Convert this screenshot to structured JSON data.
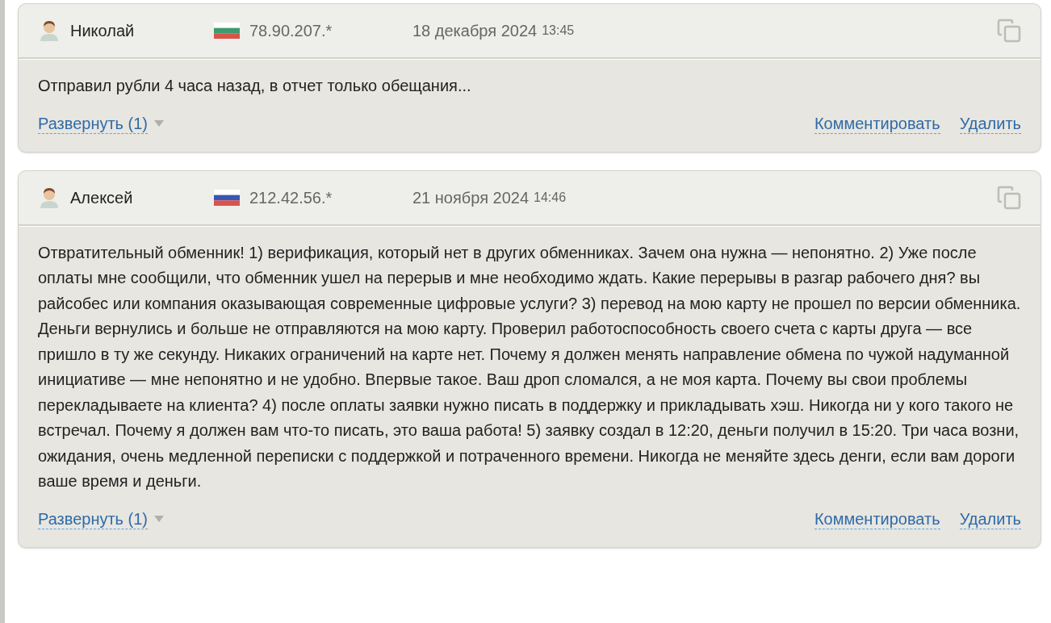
{
  "comments": [
    {
      "author": "Николай",
      "flag": {
        "kind": "bg"
      },
      "ip": "78.90.207.*",
      "date": "18 декабря 2024",
      "time": "13:45",
      "text": "Отправил рубли 4 часа назад, в отчет только обещания...",
      "expand": "Развернуть (1)",
      "actions": [
        "Комментировать",
        "Удалить"
      ]
    },
    {
      "author": "Алексей",
      "flag": {
        "kind": "ru"
      },
      "ip": "212.42.56.*",
      "date": "21 ноября 2024",
      "time": "14:46",
      "text": "Отвратительный обменник! 1) верификация, который нет в других обменниках. Зачем она нужна — непонятно. 2) Уже после оплаты мне сообщили, что обменник ушел на перерыв и мне необходимо ждать. Какие перерывы в разгар рабочего дня? вы райсобес или компания оказывающая современные цифровые услуги? 3) перевод на мою карту не прошел по версии обменника. Деньги вернулись и больше не отправляются на мою карту. Проверил работоспособность своего счета с карты друга — все пришло в ту же секунду. Никаких ограничений на карте нет. Почему я должен менять направление обмена по чужой надуманной инициативе — мне непонятно и не удобно. Впервые такое. Ваш дроп сломался, а не моя карта. Почему вы свои проблемы перекладываете на клиента? 4) после оплаты заявки нужно писать в поддержку и прикладывать хэш. Никогда ни у кого такого не встречал. Почему я должен вам что-то писать, это ваша работа! 5) заявку создал в 12:20, деньги получил в 15:20. Три часа возни, ожидания, очень медленной переписки с поддержкой и потраченного времени. Никогда не меняйте здесь денги, если вам дороги ваше время и деньги.",
      "expand": "Развернуть (1)",
      "actions": [
        "Комментировать",
        "Удалить"
      ]
    }
  ]
}
